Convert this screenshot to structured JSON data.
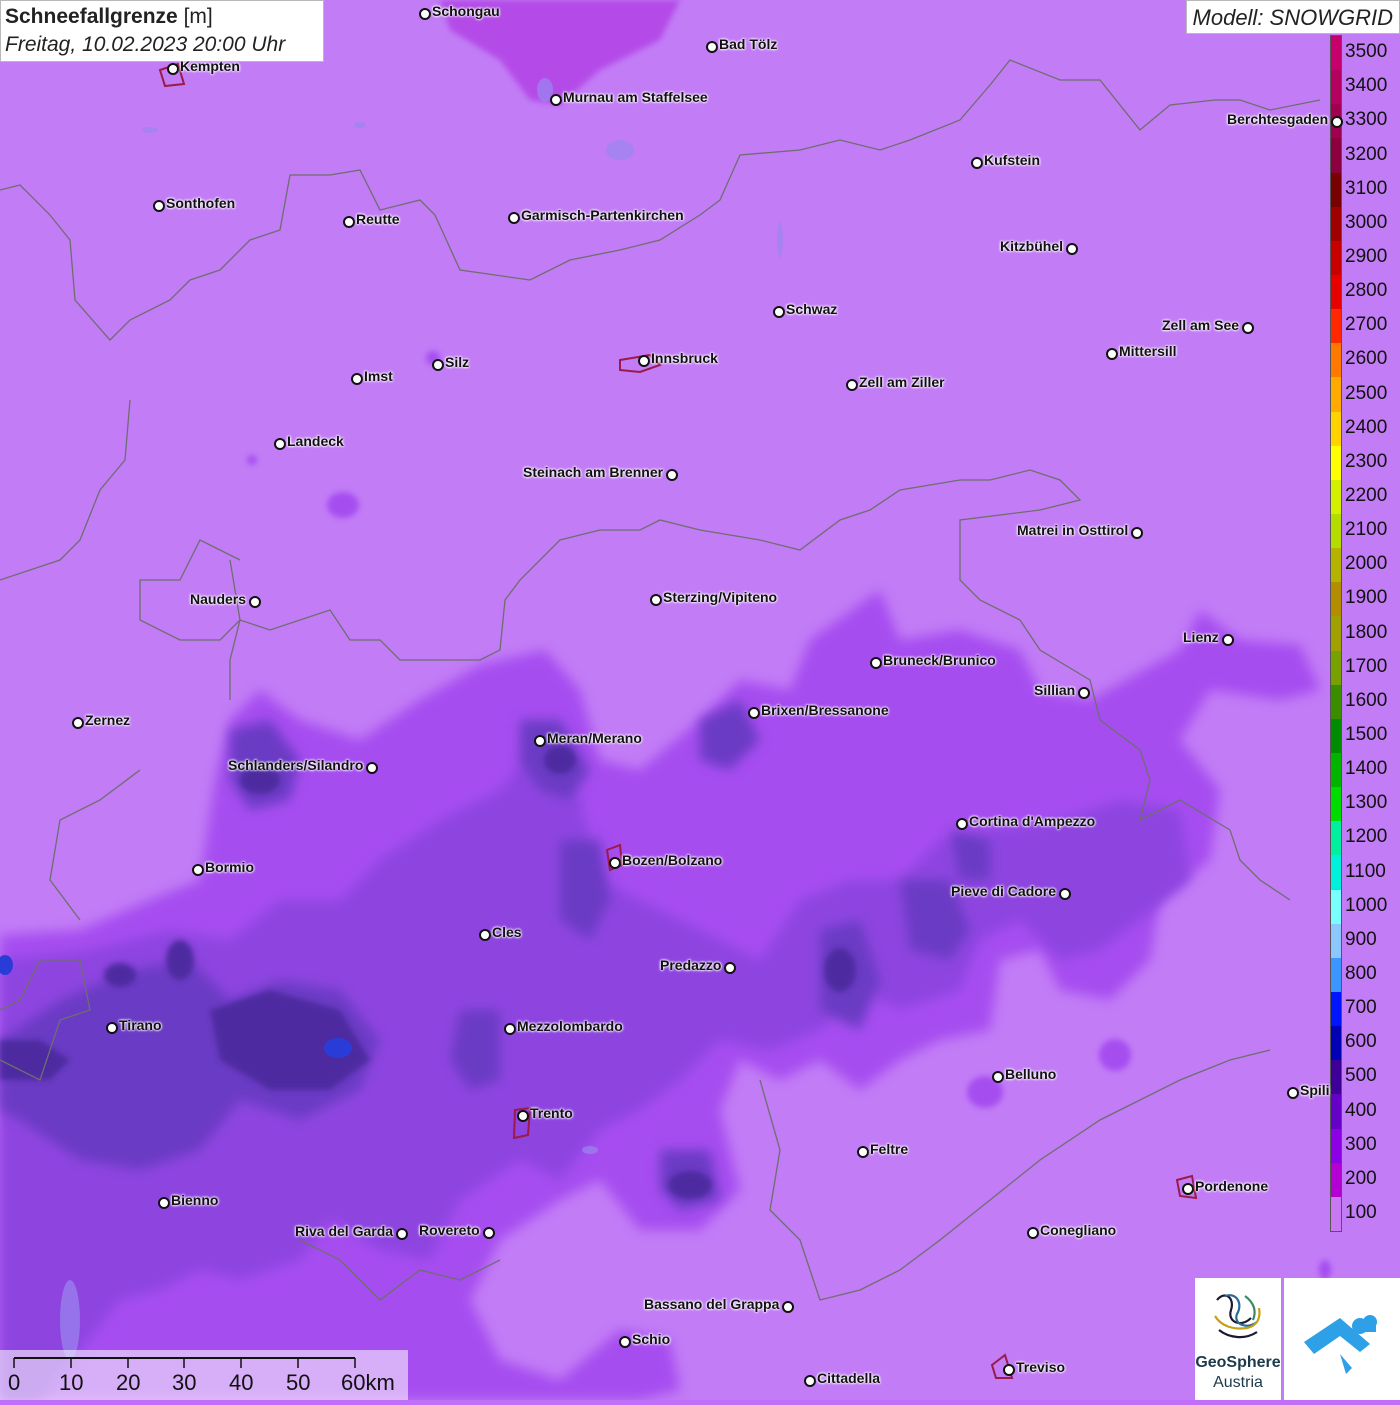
{
  "title": {
    "param": "Schneefallgrenze",
    "unit": "[m]",
    "datetime": "Freitag, 10.02.2023 20:00 Uhr"
  },
  "model": "Modell: SNOWGRID",
  "legend": {
    "labels": [
      "3500",
      "3400",
      "3300",
      "3200",
      "3100",
      "3000",
      "2900",
      "2800",
      "2700",
      "2600",
      "2500",
      "2400",
      "2300",
      "2200",
      "2100",
      "2000",
      "1900",
      "1800",
      "1700",
      "1600",
      "1500",
      "1400",
      "1300",
      "1200",
      "1100",
      "1000",
      "900",
      "800",
      "700",
      "600",
      "500",
      "400",
      "300",
      "200",
      "100"
    ],
    "colors": [
      "#c8006e",
      "#b4005f",
      "#a00050",
      "#8c0040",
      "#780000",
      "#a00000",
      "#c80000",
      "#e60000",
      "#ff2800",
      "#ff7800",
      "#ffaa00",
      "#ffd200",
      "#ffff00",
      "#d2f000",
      "#b4dc00",
      "#b4b400",
      "#b48c00",
      "#a0a000",
      "#78a000",
      "#3c8c00",
      "#008c00",
      "#00b400",
      "#00dc00",
      "#00f0a0",
      "#00f0dc",
      "#78ffff",
      "#8cc8ff",
      "#3c96ff",
      "#0014ff",
      "#0000b4",
      "#3c0096",
      "#6400c8",
      "#8c00e6",
      "#b400d2",
      "#c878f0"
    ]
  },
  "cities": [
    {
      "name": "Schongau",
      "label_side": "right"
    },
    {
      "name": "Kempten",
      "label_side": "right"
    },
    {
      "name": "Bad Tölz",
      "label_side": "right"
    },
    {
      "name": "Murnau am Staffelsee",
      "label_side": "right"
    },
    {
      "name": "Berchtesgaden",
      "label_side": "left"
    },
    {
      "name": "Kufstein",
      "label_side": "right"
    },
    {
      "name": "Sonthofen",
      "label_side": "right"
    },
    {
      "name": "Reutte",
      "label_side": "right"
    },
    {
      "name": "Garmisch-Partenkirchen",
      "label_side": "right"
    },
    {
      "name": "Kitzbühel",
      "label_side": "left"
    },
    {
      "name": "Schwaz",
      "label_side": "right"
    },
    {
      "name": "Zell am See",
      "label_side": "left"
    },
    {
      "name": "Innsbruck",
      "label_side": "right"
    },
    {
      "name": "Silz",
      "label_side": "right"
    },
    {
      "name": "Mittersill",
      "label_side": "right"
    },
    {
      "name": "Imst",
      "label_side": "right"
    },
    {
      "name": "Zell am Ziller",
      "label_side": "right"
    },
    {
      "name": "Landeck",
      "label_side": "right"
    },
    {
      "name": "Steinach am Brenner",
      "label_side": "left"
    },
    {
      "name": "Matrei in Osttirol",
      "label_side": "left"
    },
    {
      "name": "Nauders",
      "label_side": "left"
    },
    {
      "name": "Sterzing/Vipiteno",
      "label_side": "right"
    },
    {
      "name": "Lienz",
      "label_side": "left"
    },
    {
      "name": "Bruneck/Brunico",
      "label_side": "right"
    },
    {
      "name": "Sillian",
      "label_side": "left"
    },
    {
      "name": "Brixen/Bressanone",
      "label_side": "right"
    },
    {
      "name": "Zernez",
      "label_side": "right"
    },
    {
      "name": "Meran/Merano",
      "label_side": "right"
    },
    {
      "name": "Schlanders/Silandro",
      "label_side": "left"
    },
    {
      "name": "Cortina d'Ampezzo",
      "label_side": "right"
    },
    {
      "name": "Bozen/Bolzano",
      "label_side": "right"
    },
    {
      "name": "Bormio",
      "label_side": "right"
    },
    {
      "name": "Pieve di Cadore",
      "label_side": "left"
    },
    {
      "name": "Cles",
      "label_side": "right"
    },
    {
      "name": "Predazzo",
      "label_side": "left"
    },
    {
      "name": "Tirano",
      "label_side": "right"
    },
    {
      "name": "Mezzolombardo",
      "label_side": "right"
    },
    {
      "name": "Belluno",
      "label_side": "right"
    },
    {
      "name": "Spili",
      "label_side": "right"
    },
    {
      "name": "Trento",
      "label_side": "right"
    },
    {
      "name": "Feltre",
      "label_side": "right"
    },
    {
      "name": "Pordenone",
      "label_side": "right"
    },
    {
      "name": "Bienno",
      "label_side": "right"
    },
    {
      "name": "Riva del Garda",
      "label_side": "left"
    },
    {
      "name": "Rovereto",
      "label_side": "left"
    },
    {
      "name": "Conegliano",
      "label_side": "right"
    },
    {
      "name": "Bassano del Grappa",
      "label_side": "left"
    },
    {
      "name": "Schio",
      "label_side": "right"
    },
    {
      "name": "Treviso",
      "label_side": "right"
    },
    {
      "name": "Cittadella",
      "label_side": "right"
    }
  ],
  "scale": {
    "ticks": [
      "0",
      "10",
      "20",
      "30",
      "40",
      "50",
      "60km"
    ]
  },
  "logos": {
    "geosphere_line1": "GeoSphere",
    "geosphere_line2": "Austria"
  }
}
